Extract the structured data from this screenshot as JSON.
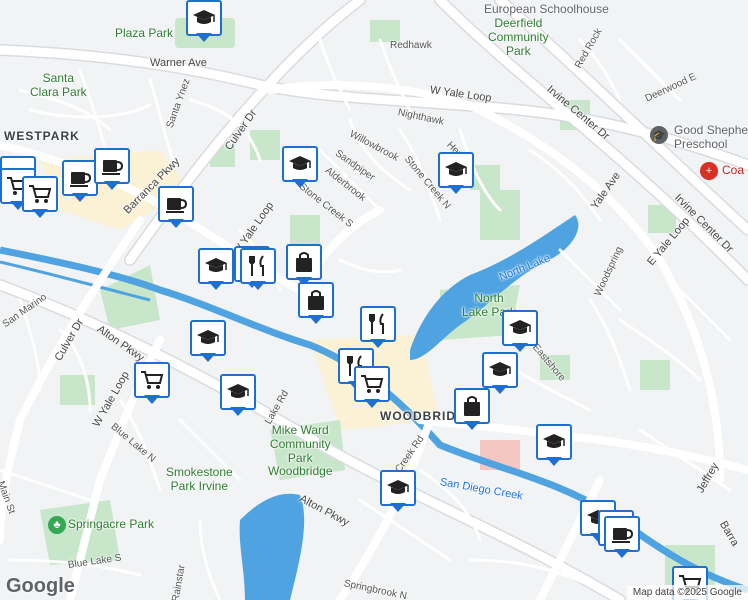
{
  "labels": {
    "european_schoolhouse": "European Schoolhouse",
    "deerfield_park": "Deerfield\nCommunity\nPark",
    "plaza_park": "Plaza Park",
    "redhawk": "Redhawk",
    "red_rock": "Red Rock",
    "deerwood": "Deerwood E",
    "warner_ave": "Warner Ave",
    "santa_clara_park": "Santa\nClara Park",
    "santa_ynez": "Santa Ynez",
    "w_yale_loop_top": "W Yale Loop",
    "nighthawk": "Nighthawk",
    "irvine_center_dr_1": "Irvine Center Dr",
    "irvine_center_dr_2": "Irvine Center Dr",
    "good_shepherd": "Good Shepherd\nPreschool",
    "coast": "Coa",
    "westpark": "WESTPARK",
    "culver_dr_top": "Culver Dr",
    "willowbrook": "Willowbrook",
    "sandpiper": "Sandpiper",
    "alderbrook": "Alderbrook",
    "stone_creek_s": "Stone Creek S",
    "stone_creek_n": "Stone Creek N",
    "heron": "Her",
    "yale_ave": "Yale Ave",
    "barranca": "Barranca Pkwy",
    "e_yale_loop": "E Yale Loop",
    "w_yale_loop_mid": "W Yale Loop",
    "north_lake": "North Lake",
    "north_lake_park": "North\nLake Park",
    "woodspring": "Woodspring",
    "san_marino": "San Marino",
    "culver_dr_bottom": "Culver Dr",
    "alton_pkwy_left": "Alton Pkwy",
    "w_yale_loop_bottom": "W Yale Loop",
    "eastshore": "Eastshore",
    "woodbridge": "WOODBRIDGE",
    "lake_rd": "Lake Rd",
    "blue_lake_n": "Blue Lake N",
    "mike_ward": "Mike Ward\nCommunity\nPark\nWoodbridge",
    "creek_rd": "Creek Rd",
    "san_diego_creek": "San Diego Creek",
    "smokestone": "Smokestone\nPark Irvine",
    "jeffrey": "Jeffrey",
    "barranca_right": "Barra",
    "main_st": "Main St",
    "alton_pkwy_bottom": "Alton Pkwy",
    "springacre": "Springacre Park",
    "blue_lake_s": "Blue Lake S",
    "rainstar": "Rainstar",
    "springbrook": "Springbrook N"
  },
  "attribution": "Map data ©2025 Google",
  "logo": "Google",
  "colors": {
    "background": "#f1f3f4",
    "road": "#ffffff",
    "major_road": "#ffffff",
    "park": "#c8e6c9",
    "water": "#4fa3e0",
    "commercial": "#fbf2d6",
    "pin_border": "#1e6fd0"
  },
  "markers": [
    {
      "icon": "school"
    },
    {
      "icon": "cafe"
    },
    {
      "icon": "shopping-cart"
    },
    {
      "icon": "shopping-cart"
    },
    {
      "icon": "cafe"
    },
    {
      "icon": "cafe"
    },
    {
      "icon": "school"
    },
    {
      "icon": "school"
    },
    {
      "icon": "cafe"
    },
    {
      "icon": "school"
    },
    {
      "icon": "restaurant"
    },
    {
      "icon": "restaurant"
    },
    {
      "icon": "shopping-bag"
    },
    {
      "icon": "shopping-bag"
    },
    {
      "icon": "restaurant"
    },
    {
      "icon": "school"
    },
    {
      "icon": "school"
    },
    {
      "icon": "restaurant"
    },
    {
      "icon": "shopping-cart"
    },
    {
      "icon": "school"
    },
    {
      "icon": "school"
    },
    {
      "icon": "shopping-cart"
    },
    {
      "icon": "school"
    },
    {
      "icon": "shopping-bag"
    },
    {
      "icon": "school"
    },
    {
      "icon": "school"
    },
    {
      "icon": "cafe"
    },
    {
      "icon": "cafe"
    },
    {
      "icon": "shopping-cart"
    }
  ]
}
